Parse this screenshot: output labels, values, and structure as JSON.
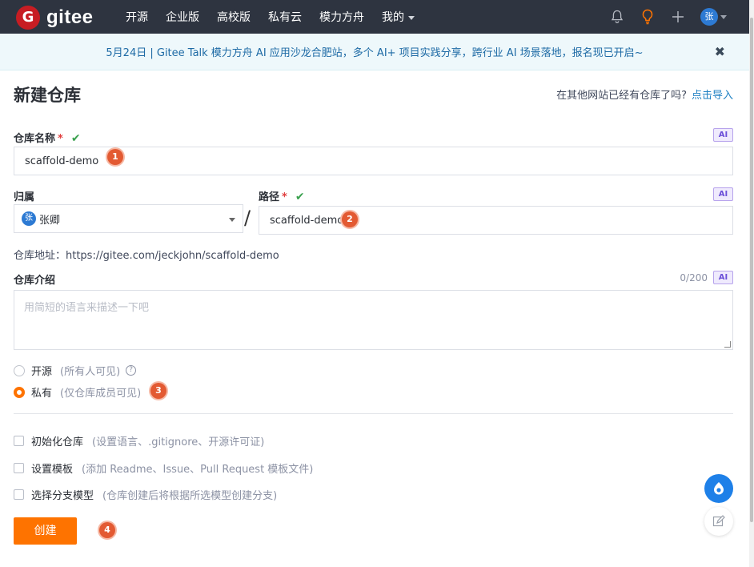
{
  "nav": {
    "logo_text": "gitee",
    "links": [
      "开源",
      "企业版",
      "高校版",
      "私有云",
      "模力方舟",
      "我的"
    ],
    "avatar_text": "张"
  },
  "banner": {
    "text": "5月24日 | Gitee Talk 模力方舟 AI 应用沙龙合肥站，多个 AI+ 项目实践分享，跨行业 AI 场景落地，报名现已开启~",
    "close": "✖"
  },
  "header": {
    "title": "新建仓库",
    "import_hint": "在其他网站已经有仓库了吗?",
    "import_link": "点击导入"
  },
  "form": {
    "ai_badge": "AI",
    "repo_name": {
      "label": "仓库名称",
      "required": "*",
      "value": "scaffold-demo"
    },
    "owner": {
      "label": "归属",
      "avatar_text": "张",
      "value": "张卿"
    },
    "path": {
      "label": "路径",
      "required": "*",
      "value": "scaffold-demo"
    },
    "slash": "/",
    "repo_url": "仓库地址：https://gitee.com/jeckjohn/scaffold-demo",
    "description": {
      "label": "仓库介绍",
      "counter": "0/200",
      "placeholder": "用简短的语言来描述一下吧"
    },
    "visibility": [
      {
        "label": "开源",
        "hint": "(所有人可见)",
        "selected": false
      },
      {
        "label": "私有",
        "hint": "(仅仓库成员可见)",
        "selected": true
      }
    ],
    "options": [
      {
        "label": "初始化仓库",
        "hint": "(设置语言、.gitignore、开源许可证)"
      },
      {
        "label": "设置模板",
        "hint": "(添加 Readme、Issue、Pull Request 模板文件)"
      },
      {
        "label": "选择分支模型",
        "hint": "(仓库创建后将根据所选模型创建分支)"
      }
    ],
    "create_button": "创建"
  },
  "steps": [
    "1",
    "2",
    "3",
    "4"
  ],
  "colors": {
    "nav_bg": "#2e3440",
    "accent": "#fe7300",
    "link": "#1e80c3",
    "step": "#e35a32"
  }
}
